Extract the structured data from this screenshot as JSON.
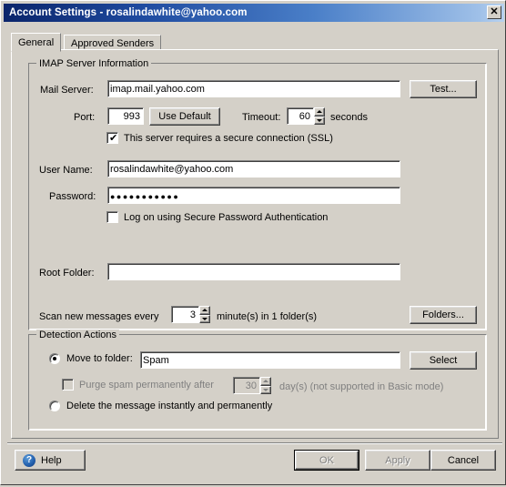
{
  "window": {
    "title": "Account Settings - rosalindawhite@yahoo.com",
    "close_icon": "✕"
  },
  "tabs": [
    {
      "label": "General",
      "selected": true
    },
    {
      "label": "Approved Senders",
      "selected": false
    }
  ],
  "imap_group": {
    "legend": "IMAP Server Information",
    "mail_server": {
      "label": "Mail Server:",
      "value": "imap.mail.yahoo.com"
    },
    "test_button": "Test...",
    "port": {
      "label": "Port:",
      "value": "993"
    },
    "use_default_button": "Use Default",
    "timeout": {
      "label": "Timeout:",
      "value": "60",
      "units": "seconds"
    },
    "ssl_checkbox": {
      "label": "This server requires a secure connection (SSL)",
      "checked": true,
      "tick": "✔"
    },
    "user_name": {
      "label": "User Name:",
      "value": "rosalindawhite@yahoo.com"
    },
    "password": {
      "label": "Password:",
      "value": "●●●●●●●●●●●"
    },
    "spa_checkbox": {
      "label": "Log on using Secure Password Authentication",
      "checked": false
    },
    "root_folder": {
      "label": "Root Folder:",
      "value": ""
    },
    "scan": {
      "prefix_label": "Scan new messages every",
      "value": "3",
      "suffix_label": "minute(s) in 1 folder(s)"
    },
    "folders_button": "Folders..."
  },
  "detection_group": {
    "legend": "Detection Actions",
    "move_radio": {
      "label": "Move to folder:",
      "selected": true
    },
    "move_folder_value": "Spam",
    "select_button": "Select",
    "purge": {
      "checkbox_label": "Purge spam permanently after",
      "value": "30",
      "suffix_label": "day(s) (not supported in Basic mode)",
      "checked": false,
      "enabled": false
    },
    "delete_radio": {
      "label": "Delete the message instantly and permanently",
      "selected": false
    }
  },
  "footer": {
    "help_button": "Help",
    "help_icon": "?",
    "ok_button": "OK",
    "apply_button": "Apply",
    "cancel_button": "Cancel"
  },
  "colors": {
    "dialog_face": "#d4d0c8",
    "title_gradient_start": "#0a246a",
    "title_gradient_end": "#b8d2ef",
    "field_background": "#ffffff",
    "disabled_text": "#808080"
  }
}
